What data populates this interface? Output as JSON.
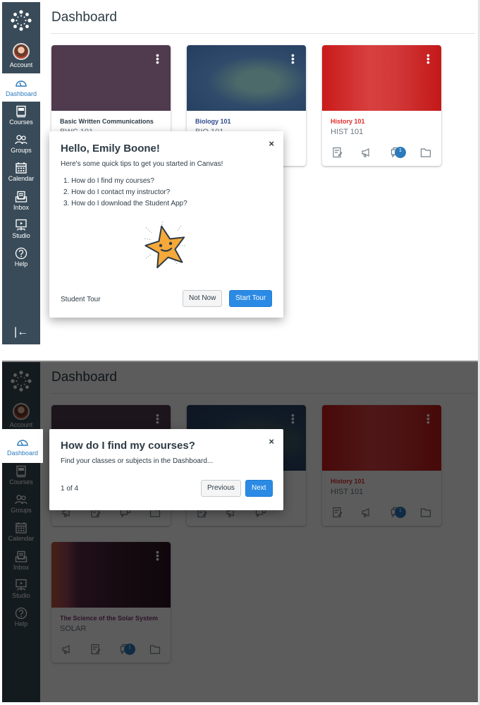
{
  "colors": {
    "sidebar": "#394b58",
    "accent": "#2b8ae4",
    "active_link": "#2b7abc",
    "bwc": "#4f3a4e",
    "bio": "#2a4a6b",
    "hist": "#c91a1a",
    "solar": "#3a1f2c"
  },
  "sidebar": {
    "items": [
      {
        "label": "Account",
        "icon": "avatar"
      },
      {
        "label": "Dashboard",
        "icon": "dashboard-icon"
      },
      {
        "label": "Courses",
        "icon": "courses-icon"
      },
      {
        "label": "Groups",
        "icon": "groups-icon"
      },
      {
        "label": "Calendar",
        "icon": "calendar-icon"
      },
      {
        "label": "Inbox",
        "icon": "inbox-icon"
      },
      {
        "label": "Studio",
        "icon": "studio-icon"
      },
      {
        "label": "Help",
        "icon": "help-icon"
      }
    ],
    "collapse_glyph": "|←"
  },
  "page": {
    "title": "Dashboard"
  },
  "cards": [
    {
      "name": "Basic Written Communications",
      "code": "BWC 101",
      "name_color": "#4f3a4e"
    },
    {
      "name": "Biology 101",
      "code": "BIO 101",
      "name_color": "#2a4a8b"
    },
    {
      "name": "History 101",
      "code": "HIST 101",
      "name_color": "#e02b2b",
      "badge": "1"
    },
    {
      "name": "The Science of the Solar System",
      "code": "SOLAR",
      "name_color": "#7a3a7a",
      "badge": "1"
    }
  ],
  "kebab_glyph": "⋮",
  "welcome": {
    "title": "Hello, Emily Boone!",
    "intro": "Here's some quick tips to get you started in Canvas!",
    "tips": [
      "1. How do I find my courses?",
      "2. How do I contact my instructor?",
      "3. How do I download the Student App?"
    ],
    "footer_label": "Student Tour",
    "not_now": "Not Now",
    "start_tour": "Start Tour",
    "close": "×"
  },
  "tour_step": {
    "title": "How do I find my courses?",
    "body": "Find your classes or subjects in the Dashboard...",
    "progress": "1 of 4",
    "previous": "Previous",
    "next": "Next",
    "close": "×"
  }
}
